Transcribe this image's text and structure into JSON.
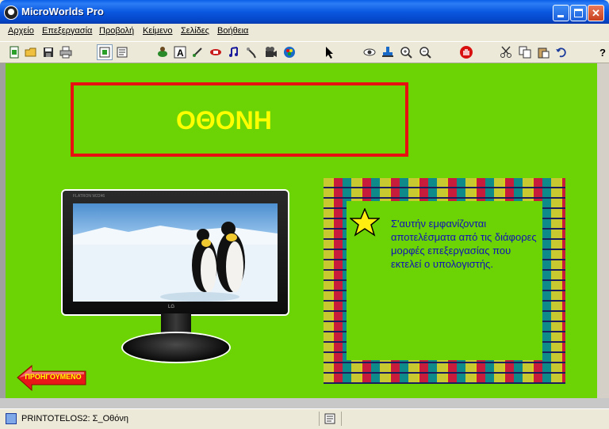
{
  "window": {
    "title": "MicroWorlds Pro",
    "minimize_label": "",
    "maximize_label": "",
    "close_label": "✕"
  },
  "menu": [
    {
      "label": "Αρχείο"
    },
    {
      "label": "Επεξεργασία"
    },
    {
      "label": "Προβολή"
    },
    {
      "label": "Κείμενο"
    },
    {
      "label": "Σελίδες"
    },
    {
      "label": "Βοήθεια"
    }
  ],
  "toolbar": {
    "icons": [
      "new-page-icon",
      "open-icon",
      "save-icon",
      "print-icon",
      "project-view-icon",
      "procedures-view-icon",
      "hatch-turtle-icon",
      "text-box-icon",
      "button-icon",
      "slider-icon",
      "melody-icon",
      "sound-icon",
      "video-icon",
      "colors-icon",
      "pointer-icon",
      "eye-icon",
      "stamp-icon",
      "zoom-in-icon",
      "zoom-out-icon",
      "stop-icon",
      "cut-icon",
      "copy-icon",
      "paste-icon",
      "undo-icon",
      "help-icon"
    ]
  },
  "page": {
    "heading": "ΟΘΟΝΗ",
    "description": "Σ'αυτήν εμφανίζονται αποτελέσματα από τις διάφορες μορφές επεξεργασίας που εκτελεί ο υπολογιστής.",
    "back_label": "ΠΡΟΗΓΟΥΜΕΝΟ",
    "monitor_brand": "FLATRON W2246",
    "monitor_logo": "LG",
    "colors": {
      "background": "#6cd404",
      "heading": "#ffff00",
      "heading_border": "#e81010",
      "description": "#1010b8"
    }
  },
  "statusbar": {
    "page_label": "PRINTOTELOS2: Σ_Οθόνη"
  }
}
